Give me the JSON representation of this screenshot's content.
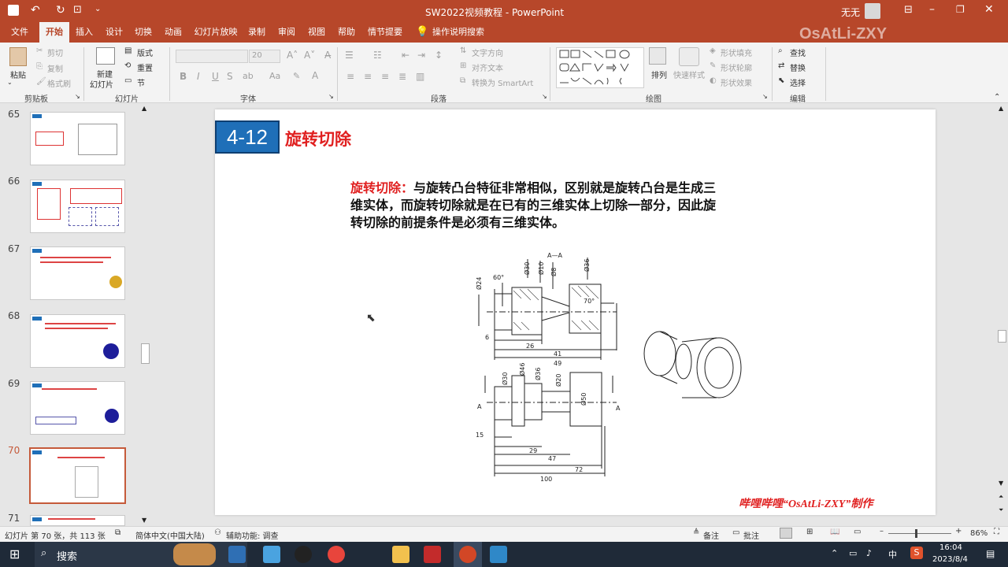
{
  "titlebar": {
    "doc_title": "SW2022视频教程 - PowerPoint",
    "user": "无无"
  },
  "tabs": [
    "文件",
    "开始",
    "插入",
    "设计",
    "切换",
    "动画",
    "幻灯片放映",
    "录制",
    "审阅",
    "视图",
    "帮助",
    "情节提要"
  ],
  "tell_me": "操作说明搜索",
  "watermark": "OsAtLi-ZXY",
  "ribbon": {
    "clipboard": {
      "paste": "粘贴",
      "cut": "剪切",
      "copy": "复制",
      "format_painter": "格式刷",
      "label": "剪贴板"
    },
    "slides": {
      "new_slide_1": "新建",
      "new_slide_2": "幻灯片",
      "layout": "版式",
      "reset": "重置",
      "section": "节",
      "label": "幻灯片"
    },
    "font": {
      "size": "20",
      "label": "字体"
    },
    "paragraph": {
      "text_direction": "文字方向",
      "align_text": "对齐文本",
      "smartart": "转换为 SmartArt",
      "label": "段落"
    },
    "drawing": {
      "arrange": "排列",
      "quick_styles": "快速样式",
      "shape_fill": "形状填充",
      "shape_outline": "形状轮廓",
      "shape_effects": "形状效果",
      "label": "绘图"
    },
    "editing": {
      "find": "查找",
      "replace": "替换",
      "select": "选择",
      "label": "编辑"
    }
  },
  "thumbnails": [
    {
      "num": "65",
      "selected": false
    },
    {
      "num": "66",
      "selected": false
    },
    {
      "num": "67",
      "selected": false
    },
    {
      "num": "68",
      "selected": false
    },
    {
      "num": "69",
      "selected": false
    },
    {
      "num": "70",
      "selected": true
    },
    {
      "num": "71",
      "selected": false
    }
  ],
  "slide": {
    "number_box": "4-12",
    "heading": "旋转切除",
    "body_label": "旋转切除：",
    "body_line1": "与旋转凸台特征非常相似，区别就是旋转凸台是生成三",
    "body_line2": "维实体，而旋转切除就是在已有的三维实体上切除一部分，因此旋",
    "body_line3": "转切除的前提条件是必须有三维实体。",
    "footer": "哔哩哔哩“OsAtLi-ZXY”制作",
    "drawing_labels": {
      "section": "A—A",
      "d24": "Ø24",
      "d30": "Ø30",
      "d10": "Ø10",
      "d8": "Ø8",
      "d36": "Ø36",
      "a60": "60°",
      "a70": "70°",
      "dim6": "6",
      "dim26": "26",
      "dim41": "41",
      "dim49": "49",
      "d46": "Ø46",
      "d20": "Ø20",
      "d50": "Ø50",
      "cutA": "A",
      "dim15": "15",
      "dim29": "29",
      "dim47": "47",
      "dim72": "72",
      "dim100": "100"
    }
  },
  "statusbar": {
    "slide_info": "幻灯片 第 70 张，共 113 张",
    "language": "简体中文(中国大陆)",
    "accessibility": "辅助功能: 调查",
    "notes": "备注",
    "comments": "批注",
    "zoom": "86%"
  },
  "taskbar": {
    "search": "搜索",
    "ime1": "中",
    "ime2": "S",
    "time": "16:04",
    "date": "2023/8/4"
  },
  "colors": {
    "accent": "#b7472a",
    "slide_heading": "#e02020",
    "number_box": "#1f6fb8"
  }
}
